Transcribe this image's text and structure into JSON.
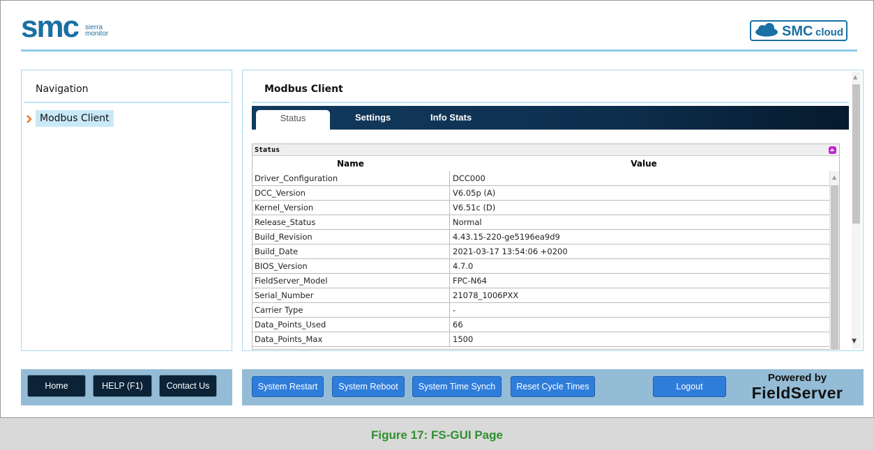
{
  "header": {
    "logo_main": "smc",
    "logo_sub_1": "sierra",
    "logo_sub_2": "monitor",
    "cloud_button": "SMC cloud",
    "cloud_logo_main": "SMC",
    "cloud_logo_sub": "cloud"
  },
  "navigation": {
    "title": "Navigation",
    "items": [
      {
        "label": "Modbus Client",
        "selected": true
      }
    ]
  },
  "main": {
    "title": "Modbus Client",
    "tabs": [
      {
        "label": "Status",
        "active": true
      },
      {
        "label": "Settings",
        "active": false
      },
      {
        "label": "Info Stats",
        "active": false
      }
    ],
    "status": {
      "heading": "Status",
      "columns": [
        "Name",
        "Value"
      ],
      "rows": [
        {
          "name": "Driver_Configuration",
          "value": "DCC000"
        },
        {
          "name": "DCC_Version",
          "value": "V6.05p (A)"
        },
        {
          "name": "Kernel_Version",
          "value": "V6.51c (D)"
        },
        {
          "name": "Release_Status",
          "value": "Normal"
        },
        {
          "name": "Build_Revision",
          "value": "4.43.15-220-ge5196ea9d9"
        },
        {
          "name": "Build_Date",
          "value": "2021-03-17 13:54:06 +0200"
        },
        {
          "name": "BIOS_Version",
          "value": "4.7.0"
        },
        {
          "name": "FieldServer_Model",
          "value": "FPC-N64"
        },
        {
          "name": "Serial_Number",
          "value": "21078_1006PXX"
        },
        {
          "name": "Carrier Type",
          "value": "-"
        },
        {
          "name": "Data_Points_Used",
          "value": "66"
        },
        {
          "name": "Data_Points_Max",
          "value": "1500"
        }
      ]
    }
  },
  "footer_left": {
    "buttons": [
      "Home",
      "HELP (F1)",
      "Contact Us"
    ]
  },
  "footer_right": {
    "buttons": [
      "System Restart",
      "System Reboot",
      "System Time Synch",
      "Reset Cycle Times"
    ],
    "logout": "Logout",
    "powered_by": "Powered by",
    "brand": "FieldServer"
  },
  "caption": "Figure 17: FS-GUI Page",
  "colors": {
    "accent": "#8ecbe8",
    "dark_button": "#0b2237",
    "blue_button": "#2f7ddb",
    "caption_green": "#2f8f2f",
    "logo_blue": "#1a6fa3"
  }
}
